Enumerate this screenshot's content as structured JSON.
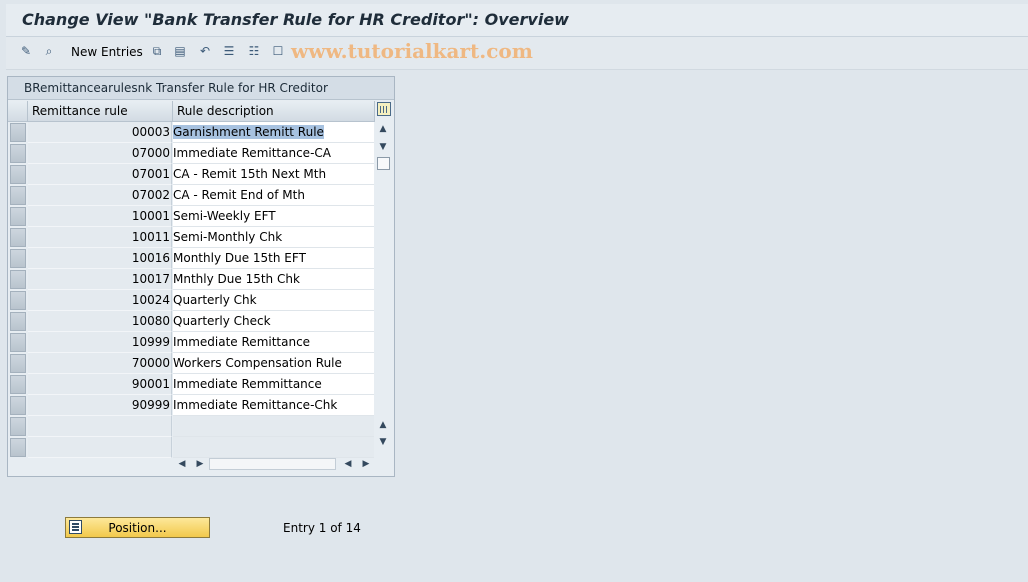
{
  "title": "Change View \"Bank Transfer Rule for HR Creditor\": Overview",
  "toolbar": {
    "icons": [
      "display-change-icon",
      "find-icon",
      "copy-icon",
      "delete-icon",
      "undo-icon",
      "select-all-icon",
      "select-block-icon",
      "deselect-all-icon"
    ],
    "new_entries_label": "New Entries"
  },
  "watermark": "www.tutorialkart.com",
  "table": {
    "title": "BRemittancearulesnk Transfer Rule for HR Creditor",
    "columns": [
      "Remittance rule",
      "Rule description"
    ],
    "rows": [
      {
        "code": "00003",
        "desc": "Garnishment Remitt Rule"
      },
      {
        "code": "07000",
        "desc": "Immediate Remittance-CA"
      },
      {
        "code": "07001",
        "desc": "CA - Remit 15th Next Mth"
      },
      {
        "code": "07002",
        "desc": "CA - Remit End of Mth"
      },
      {
        "code": "10001",
        "desc": "Semi-Weekly EFT"
      },
      {
        "code": "10011",
        "desc": "Semi-Monthly Chk"
      },
      {
        "code": "10016",
        "desc": "Monthly Due 15th EFT"
      },
      {
        "code": "10017",
        "desc": "Mnthly Due 15th Chk"
      },
      {
        "code": "10024",
        "desc": "Quarterly Chk"
      },
      {
        "code": "10080",
        "desc": "Quarterly Check"
      },
      {
        "code": "10999",
        "desc": "Immediate Remittance"
      },
      {
        "code": "70000",
        "desc": "Workers Compensation Rule"
      },
      {
        "code": "90001",
        "desc": "Immediate Remmittance"
      },
      {
        "code": "90999",
        "desc": "Immediate Remittance-Chk"
      }
    ]
  },
  "footer": {
    "position_label": "Position...",
    "entry_info": "Entry 1 of 14"
  }
}
